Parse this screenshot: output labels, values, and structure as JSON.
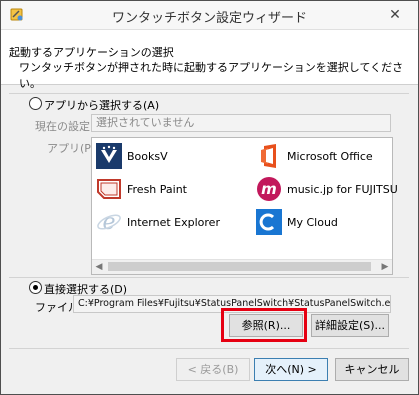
{
  "window": {
    "title": "ワンタッチボタン設定ウィザード",
    "close_label": "✕"
  },
  "header": {
    "heading": "起動するアプリケーションの選択",
    "description": "ワンタッチボタンが押された時に起動するアプリケーションを選択してください。"
  },
  "select_from_apps": {
    "radio_label": "アプリから選択する(A)",
    "selected": false,
    "current_setting_label": "現在の設定",
    "current_setting_value": "選択されていません",
    "apps_label": "アプリ(P):",
    "apps": [
      {
        "name": "BooksV",
        "icon": "booksv-icon",
        "color": "#1a3a6b"
      },
      {
        "name": "Microsoft Office",
        "icon": "microsoft-office-icon",
        "color": "#e8501c"
      },
      {
        "name": "Fresh Paint",
        "icon": "fresh-paint-icon",
        "color": "#c0392b"
      },
      {
        "name": "music.jp for FUJITSU",
        "icon": "music-jp-icon",
        "color": "#c2185b"
      },
      {
        "name": "Internet Explorer",
        "icon": "internet-explorer-icon",
        "color": "#9fb7d0"
      },
      {
        "name": "My Cloud",
        "icon": "my-cloud-icon",
        "color": "#1976d2"
      }
    ]
  },
  "direct_select": {
    "radio_label": "直接選択する(D)",
    "selected": true,
    "file_label": "ファイル",
    "file_value": "C:¥Program Files¥Fujitsu¥StatusPanelSwitch¥StatusPanelSwitch.exe",
    "browse_button": "参照(R)...",
    "details_button": "詳細設定(S)..."
  },
  "footer": {
    "back_button": "< 戻る(B)",
    "next_button": "次へ(N) >",
    "cancel_button": "キャンセル"
  },
  "colors": {
    "highlight": "#e60012"
  }
}
